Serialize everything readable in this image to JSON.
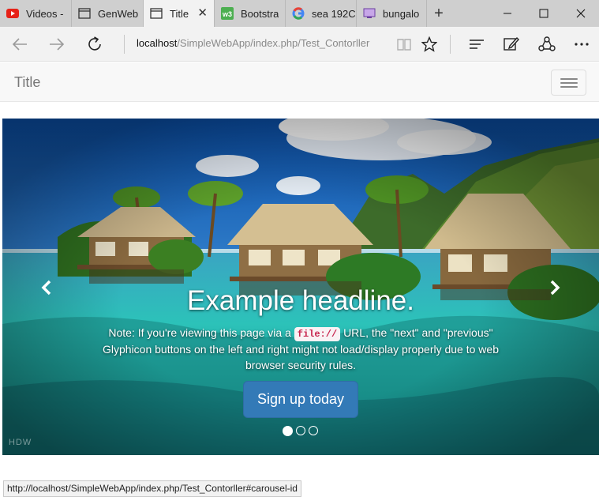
{
  "browser": {
    "tabs": [
      {
        "label": "Videos -",
        "icon": "youtube-icon",
        "active": false
      },
      {
        "label": "GenWeb",
        "icon": "page-icon",
        "active": false
      },
      {
        "label": "Title",
        "icon": "page-icon",
        "active": true
      },
      {
        "label": "Bootstra",
        "icon": "w3schools-icon",
        "active": false
      },
      {
        "label": "sea 192C",
        "icon": "google-icon",
        "active": false
      },
      {
        "label": "bungalo",
        "icon": "image-icon",
        "active": false
      }
    ],
    "new_tab_label": "+",
    "url": {
      "host": "localhost",
      "path": "/SimpleWebApp/index.php/Test_Contorller"
    },
    "status_url": "http://localhost/SimpleWebApp/index.php/Test_Contorller#carousel-id"
  },
  "page": {
    "navbar": {
      "brand": "Title"
    },
    "carousel": {
      "headline": "Example headline.",
      "note_before": "Note: If you're viewing this page via a",
      "note_code": "file://",
      "note_after": "URL, the \"next\" and \"previous\" Glyphicon buttons on the left and right might not load/display properly due to web browser security rules.",
      "cta_label": "Sign up today",
      "indicator_count": 3,
      "active_indicator": 0,
      "watermark": "HDW"
    }
  },
  "colors": {
    "cta": "#337ab7",
    "code_text": "#c7254e",
    "navbar_bg": "#f8f8f8"
  }
}
